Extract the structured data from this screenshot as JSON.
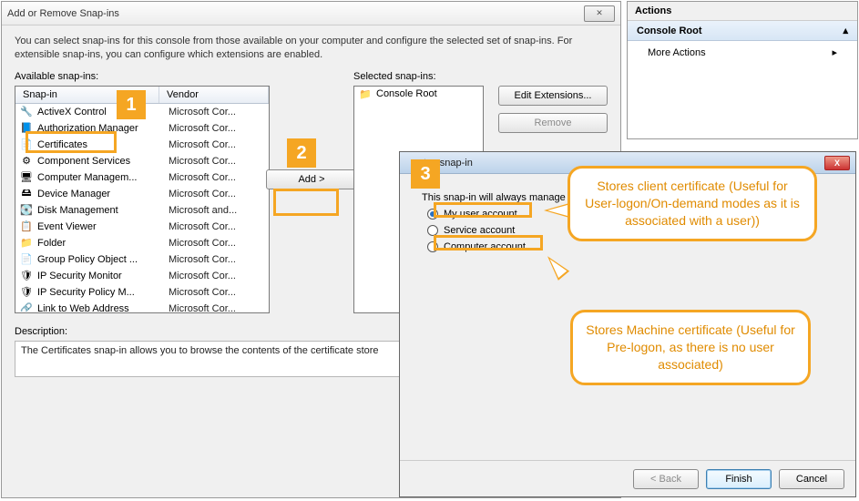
{
  "dialog": {
    "title": "Add or Remove Snap-ins",
    "intro": "You can select snap-ins for this console from those available on your computer and configure the selected set of snap-ins. For extensible snap-ins, you can configure which extensions are enabled.",
    "available_label": "Available snap-ins:",
    "selected_label": "Selected snap-ins:",
    "headers": {
      "snapin": "Snap-in",
      "vendor": "Vendor"
    },
    "add_button": "Add >",
    "edit_ext": "Edit Extensions...",
    "remove": "Remove",
    "desc_label": "Description:",
    "desc_text": "The Certificates snap-in allows you to browse the contents of the certificate store",
    "available": [
      {
        "icon": "🔧",
        "name": "ActiveX Control",
        "vendor": "Microsoft Cor..."
      },
      {
        "icon": "📘",
        "name": "Authorization Manager",
        "vendor": "Microsoft Cor..."
      },
      {
        "icon": "📄",
        "name": "Certificates",
        "vendor": "Microsoft Cor...",
        "sel": true
      },
      {
        "icon": "⚙",
        "name": "Component Services",
        "vendor": "Microsoft Cor..."
      },
      {
        "icon": "🖥",
        "name": "Computer Managem...",
        "vendor": "Microsoft Cor..."
      },
      {
        "icon": "🖴",
        "name": "Device Manager",
        "vendor": "Microsoft Cor..."
      },
      {
        "icon": "💽",
        "name": "Disk Management",
        "vendor": "Microsoft and..."
      },
      {
        "icon": "📋",
        "name": "Event Viewer",
        "vendor": "Microsoft Cor..."
      },
      {
        "icon": "📁",
        "name": "Folder",
        "vendor": "Microsoft Cor..."
      },
      {
        "icon": "📄",
        "name": "Group Policy Object ...",
        "vendor": "Microsoft Cor..."
      },
      {
        "icon": "🛡",
        "name": "IP Security Monitor",
        "vendor": "Microsoft Cor..."
      },
      {
        "icon": "🛡",
        "name": "IP Security Policy M...",
        "vendor": "Microsoft Cor..."
      },
      {
        "icon": "🔗",
        "name": "Link to Web Address",
        "vendor": "Microsoft Cor..."
      }
    ],
    "selected_tree": {
      "icon": "📁",
      "label": "Console Root"
    }
  },
  "actions": {
    "header": "Actions",
    "root": "Console Root",
    "more": "More Actions"
  },
  "wizard": {
    "title": "tes snap-in",
    "prompt": "This snap-in will always manage",
    "opt1": "My user account",
    "opt2": "Service account",
    "opt3": "Computer account",
    "back": "< Back",
    "finish": "Finish",
    "cancel": "Cancel"
  },
  "annot": {
    "n1": "1",
    "n2": "2",
    "n3": "3",
    "callout1": "Stores client certificate (Useful for User-logon/On-demand modes as it is associated with a user))",
    "callout2": "Stores Machine certificate (Useful for Pre-logon, as there is no user associated)"
  }
}
